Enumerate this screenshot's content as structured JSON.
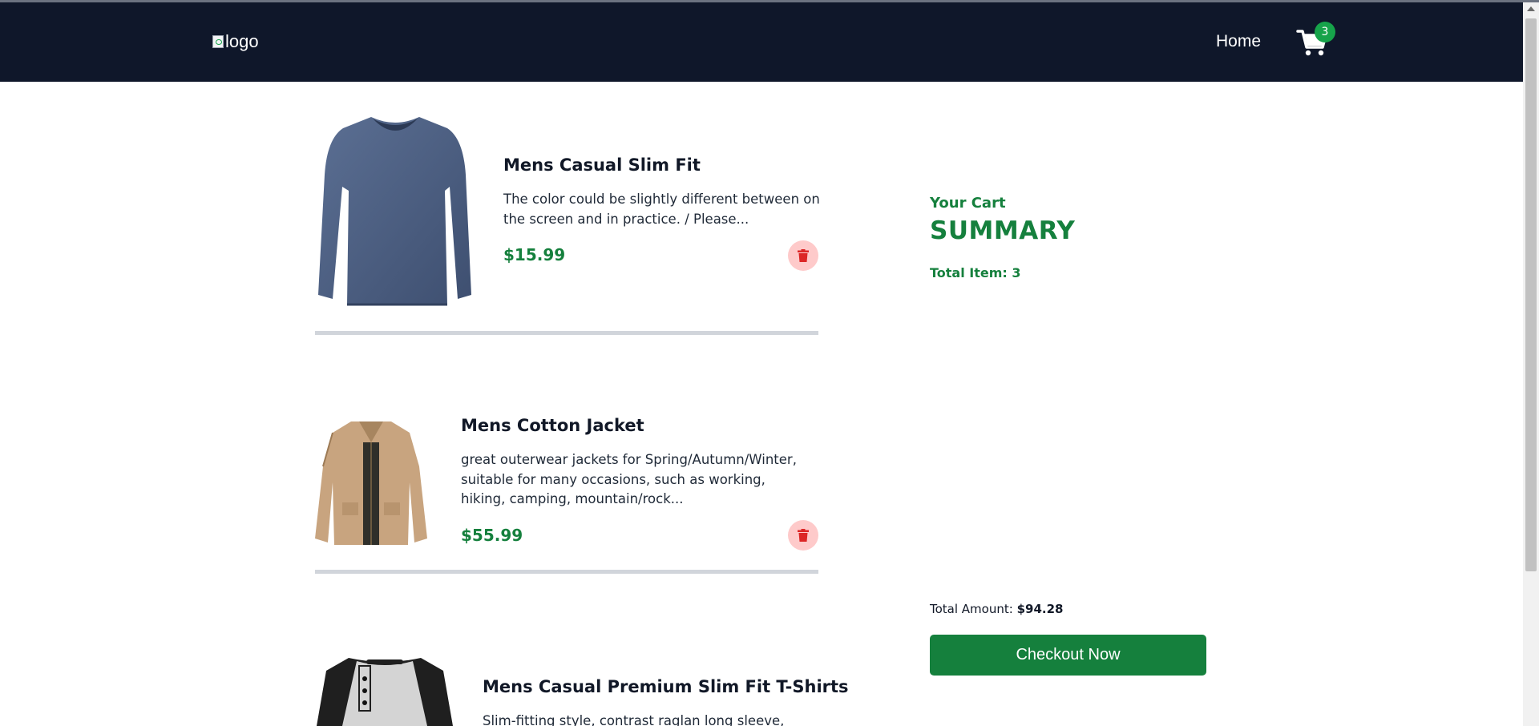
{
  "header": {
    "logo_alt": "logo",
    "nav_home": "Home",
    "cart_count": "3"
  },
  "cart_items": [
    {
      "title": "Mens Casual Slim Fit",
      "description": "The color could be slightly different between on the screen and in practice. / Please...",
      "price": "$15.99",
      "image": "blue-long-sleeve-shirt"
    },
    {
      "title": "Mens Cotton Jacket",
      "description": "great outerwear jackets for Spring/Autumn/Winter, suitable for many occasions, such as working, hiking, camping, mountain/rock...",
      "price": "$55.99",
      "image": "tan-cotton-jacket"
    },
    {
      "title": "Mens Casual Premium Slim Fit T-Shirts",
      "description": "Slim-fitting style, contrast raglan long sleeve,",
      "price": "",
      "image": "raglan-henley-shirt"
    }
  ],
  "summary": {
    "subtitle": "Your Cart",
    "title": "SUMMARY",
    "total_items_text": "Total Item: 3",
    "total_amount_label": "Total Amount:",
    "total_amount_value": "$94.28",
    "checkout_label": "Checkout Now"
  },
  "colors": {
    "navbar": "#0f172a",
    "accent_green": "#15803d",
    "badge_green": "#16a34a",
    "delete_bg": "#fecaca",
    "delete_icon": "#dc2626",
    "divider": "#d1d5db"
  },
  "icons": {
    "cart": "cart-icon",
    "delete": "trash-icon"
  }
}
